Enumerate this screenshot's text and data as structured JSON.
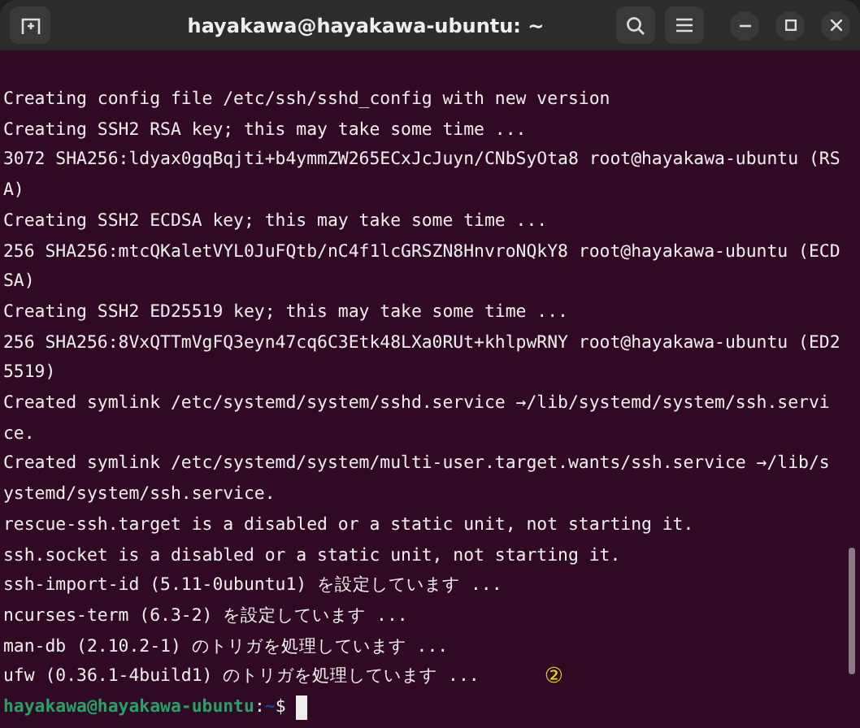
{
  "window": {
    "title": "hayakawa@hayakawa-ubuntu: ~"
  },
  "terminal": {
    "lines": [
      "Creating config file /etc/ssh/sshd_config with new version",
      "Creating SSH2 RSA key; this may take some time ...",
      "3072 SHA256:ldyax0gqBqjti+b4ymmZW265ECxJcJuyn/CNbSyOta8 root@hayakawa-ubuntu (RS",
      "A)",
      "Creating SSH2 ECDSA key; this may take some time ...",
      "256 SHA256:mtcQKaletVYL0JuFQtb/nC4f1lcGRSZN8HnvroNQkY8 root@hayakawa-ubuntu (ECD",
      "SA)",
      "Creating SSH2 ED25519 key; this may take some time ...",
      "256 SHA256:8VxQTTmVgFQ3eyn47cq6C3Etk48LXa0RUt+khlpwRNY root@hayakawa-ubuntu (ED2",
      "5519)",
      "Created symlink /etc/systemd/system/sshd.service →/lib/systemd/system/ssh.servi",
      "ce.",
      "Created symlink /etc/systemd/system/multi-user.target.wants/ssh.service →/lib/s",
      "ystemd/system/ssh.service.",
      "rescue-ssh.target is a disabled or a static unit, not starting it.",
      "ssh.socket is a disabled or a static unit, not starting it.",
      "ssh-import-id (5.11-0ubuntu1) を設定しています ...",
      "ncurses-term (6.3-2) を設定しています ...",
      "man-db (2.10.2-1) のトリガを処理しています ...",
      "ufw (0.36.1-4build1) のトリガを処理しています ..."
    ],
    "annotation": "②",
    "prompt": {
      "user_host": "hayakawa@hayakawa-ubuntu",
      "separator": ":",
      "path": "~",
      "symbol": "$"
    }
  }
}
